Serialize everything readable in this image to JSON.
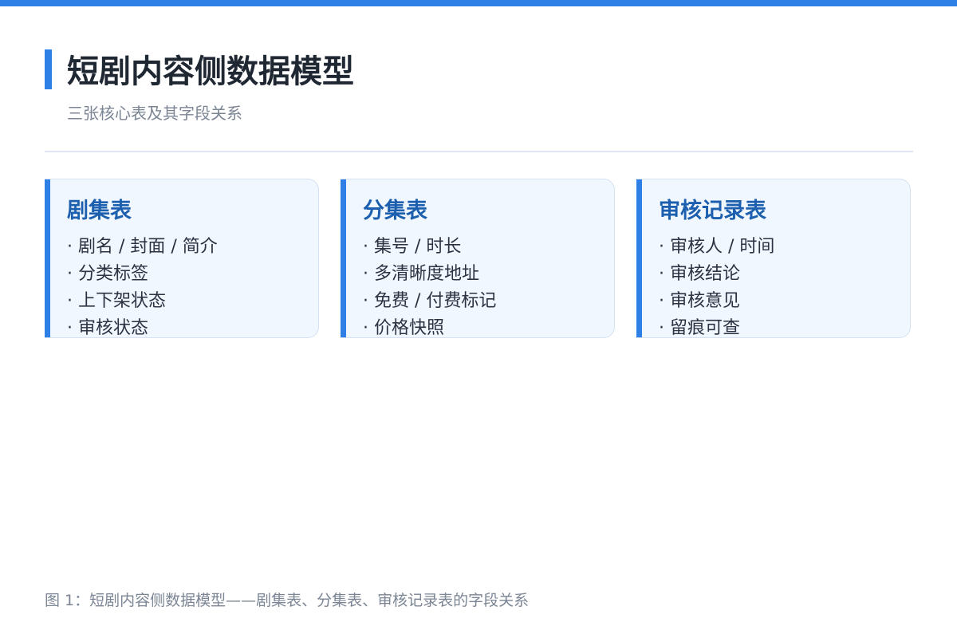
{
  "colors": {
    "accent": "#2f80e6",
    "card_title": "#1c5fae",
    "card_background": "#f1f7fe",
    "title_text": "#1f2733",
    "muted_text": "#7b8594"
  },
  "header": {
    "title": "短剧内容侧数据模型",
    "subtitle": "三张核心表及其字段关系"
  },
  "cards": [
    {
      "title": "剧集表",
      "fields": [
        "· 剧名 / 封面 / 简介",
        "· 分类标签",
        "· 上下架状态",
        "· 审核状态"
      ]
    },
    {
      "title": "分集表",
      "fields": [
        "· 集号 / 时长",
        "· 多清晰度地址",
        "· 免费 / 付费标记",
        "· 价格快照"
      ]
    },
    {
      "title": "审核记录表",
      "fields": [
        "· 审核人 / 时间",
        "· 审核结论",
        "· 审核意见",
        "· 留痕可查"
      ]
    }
  ],
  "caption": "图 1：短剧内容侧数据模型——剧集表、分集表、审核记录表的字段关系"
}
